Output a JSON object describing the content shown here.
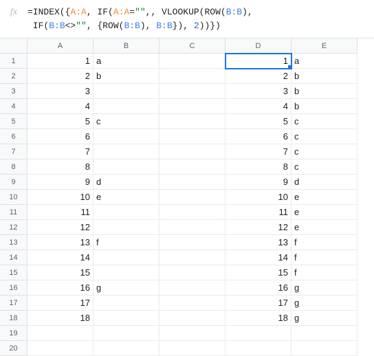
{
  "formula_bar": {
    "fx_label": "fx",
    "line1_parts": [
      {
        "t": "=INDEX({",
        "c": ""
      },
      {
        "t": "A:A",
        "c": "ref-a"
      },
      {
        "t": ", IF(",
        "c": ""
      },
      {
        "t": "A:A",
        "c": "ref-a"
      },
      {
        "t": "=",
        "c": ""
      },
      {
        "t": "\"\"",
        "c": "str"
      },
      {
        "t": ",, VLOOKUP(ROW(",
        "c": ""
      },
      {
        "t": "B:B",
        "c": "ref-b"
      },
      {
        "t": "),",
        "c": ""
      }
    ],
    "line2_parts": [
      {
        "t": " IF(",
        "c": ""
      },
      {
        "t": "B:B",
        "c": "ref-b"
      },
      {
        "t": "<>",
        "c": ""
      },
      {
        "t": "\"\"",
        "c": "str"
      },
      {
        "t": ", {ROW(",
        "c": ""
      },
      {
        "t": "B:B",
        "c": "ref-b"
      },
      {
        "t": "), ",
        "c": ""
      },
      {
        "t": "B:B",
        "c": "ref-b"
      },
      {
        "t": "}), ",
        "c": ""
      },
      {
        "t": "2",
        "c": "num"
      },
      {
        "t": "))})",
        "c": ""
      }
    ]
  },
  "columns": [
    "A",
    "B",
    "C",
    "D",
    "E"
  ],
  "row_count": 20,
  "selected": {
    "row": 1,
    "col": "D"
  },
  "cells": {
    "A": [
      "1",
      "2",
      "3",
      "4",
      "5",
      "6",
      "7",
      "8",
      "9",
      "10",
      "11",
      "12",
      "13",
      "14",
      "15",
      "16",
      "17",
      "18",
      "",
      ""
    ],
    "B": [
      "a",
      "b",
      "",
      "",
      "c",
      "",
      "",
      "",
      "d",
      "e",
      "",
      "",
      "f",
      "",
      "",
      "g",
      "",
      "",
      "",
      ""
    ],
    "C": [
      "",
      "",
      "",
      "",
      "",
      "",
      "",
      "",
      "",
      "",
      "",
      "",
      "",
      "",
      "",
      "",
      "",
      "",
      "",
      ""
    ],
    "D": [
      "1",
      "2",
      "3",
      "4",
      "5",
      "6",
      "7",
      "8",
      "9",
      "10",
      "11",
      "12",
      "13",
      "14",
      "15",
      "16",
      "17",
      "18",
      "",
      ""
    ],
    "E": [
      "a",
      "b",
      "b",
      "b",
      "c",
      "c",
      "c",
      "c",
      "d",
      "e",
      "e",
      "e",
      "f",
      "f",
      "f",
      "g",
      "g",
      "g",
      "",
      ""
    ]
  },
  "numeric_cols": [
    "A",
    "D"
  ]
}
